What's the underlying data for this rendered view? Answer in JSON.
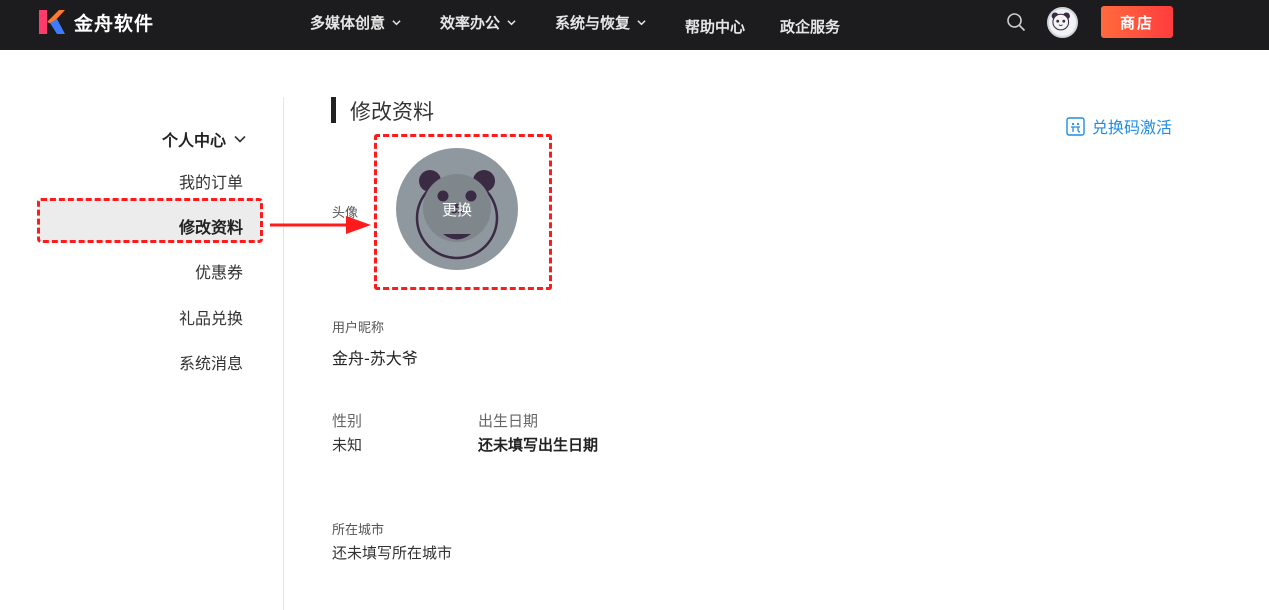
{
  "colors": {
    "topbar_bg": "#1c1c1f",
    "accent_blue": "#1f8de6",
    "shop_button": "#ff4a3d",
    "highlight": "#ff1b1b",
    "avatar_bg": "#8f989f"
  },
  "header": {
    "brand_name": "金舟软件",
    "nav": [
      {
        "label": "多媒体创意",
        "has_dropdown": true
      },
      {
        "label": "效率办公",
        "has_dropdown": true
      },
      {
        "label": "系统与恢复",
        "has_dropdown": true
      },
      {
        "label": "帮助中心",
        "has_dropdown": false
      },
      {
        "label": "政企服务",
        "has_dropdown": false
      }
    ],
    "shop_label": "商店",
    "icons": [
      "brand-logo-icon",
      "search-icon",
      "user-avatar-icon"
    ]
  },
  "sidebar": {
    "title": "个人中心",
    "items": [
      {
        "label": "我的订单",
        "active": false
      },
      {
        "label": "修改资料",
        "active": true
      },
      {
        "label": "优惠券",
        "active": false
      },
      {
        "label": "礼品兑换",
        "active": false
      },
      {
        "label": "系统消息",
        "active": false
      }
    ]
  },
  "main": {
    "title": "修改资料",
    "redeem_label": "兑换码激活",
    "avatar_label": "头像",
    "avatar_change_label": "更换",
    "nickname_label": "用户昵称",
    "nickname_value": "金舟-苏大爷",
    "gender_label": "性别",
    "gender_value": "未知",
    "birthday_label": "出生日期",
    "birthday_value": "还未填写出生日期",
    "city_label": "所在城市",
    "city_value": "还未填写所在城市"
  }
}
